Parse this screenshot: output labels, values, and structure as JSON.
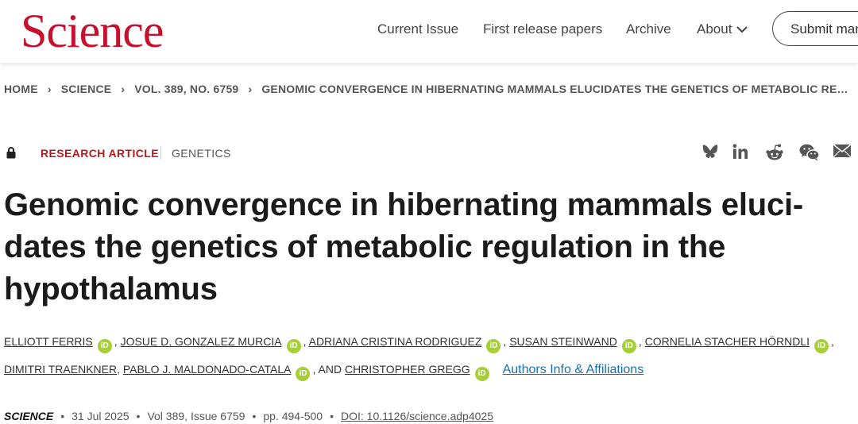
{
  "header": {
    "logo": "Science",
    "nav": [
      "Current Issue",
      "First release papers",
      "Archive",
      "About"
    ],
    "submit_label": "Submit manuscript"
  },
  "breadcrumb": {
    "home": "HOME",
    "journal": "SCIENCE",
    "issue": "VOL. 389, NO. 6759",
    "current": "GENOMIC CONVERGENCE IN HIBERNATING MAMMALS ELUCIDATES THE GENETICS OF METABOLIC REGULATION IN THE HYPOTHALAMUS"
  },
  "article": {
    "type": "RESEARCH ARTICLE",
    "subject": "GENETICS",
    "title": "Genomic convergence in hibernating mammals eluci-dates the genetics of metabolic regulation in the hypothalamus",
    "authors_line1": [
      "ELLIOTT FERRIS",
      "JOSUE D. GONZALEZ MURCIA",
      "ADRIANA CRISTINA RODRIGUEZ",
      "SUSAN STEINWAND",
      "CORNELIA STACHER HÖRNDLI"
    ],
    "authors_line2": [
      "DIMITRI TRAENKNER",
      "PABLO J. MALDONADO-CATALA"
    ],
    "and_label": "AND",
    "last_author": "CHRISTOPHER GREGG",
    "orcid_label": "iD",
    "affiliations_link": "Authors Info & Affiliations",
    "meta": {
      "journal": "SCIENCE",
      "date": "31 Jul 2025",
      "volume": "Vol 389, Issue 6759",
      "pages": "pp. 494-500",
      "doi": "DOI: 10.1126/science.adp4025"
    }
  },
  "share_icons": [
    "bluesky-icon",
    "linkedin-icon",
    "reddit-icon",
    "wechat-icon",
    "email-icon"
  ],
  "colors": {
    "brand": "#c8102e",
    "article_type": "#b31b1b",
    "orcid": "#a6ce39",
    "link": "#1a6fb3"
  }
}
